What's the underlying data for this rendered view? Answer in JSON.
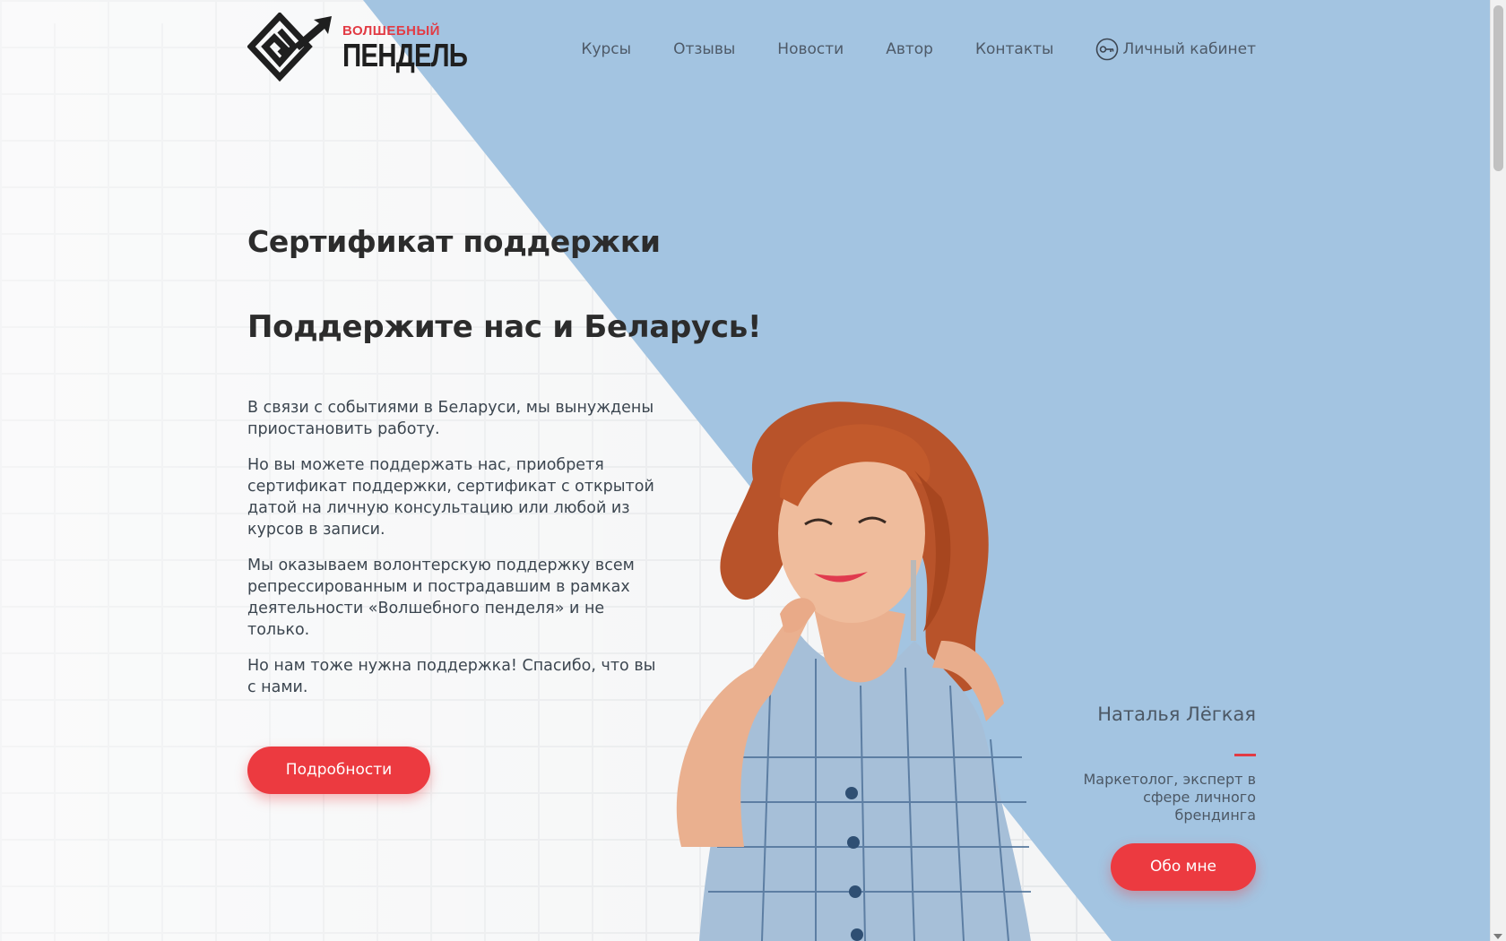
{
  "header": {
    "logo_top": "ВОЛШЕБНЫЙ",
    "logo_bottom": "ПЕНДЕЛЬ",
    "nav": [
      {
        "label": "Курсы"
      },
      {
        "label": "Отзывы"
      },
      {
        "label": "Новости"
      },
      {
        "label": "Автор"
      },
      {
        "label": "Контакты"
      }
    ],
    "cabinet_label": "Личный кабинет",
    "cabinet_icon": "key-icon"
  },
  "main": {
    "title": "Сертификат поддержки",
    "subtitle": "Поддержите нас и Беларусь!",
    "paragraphs": [
      "В связи с событиями в Беларуси, мы вынуждены приостановить работу.",
      "Но вы можете поддержать нас, приобретя сертификат поддержки, сертификат с открытой датой на личную консультацию или любой из курсов в записи.",
      "Мы оказываем волонтерскую поддержку всем репрессированным и пострадавшим в рамках деятельности «Волшебного пенделя» и не только.",
      "Но нам тоже нужна поддержка! Спасибо, что вы с нами."
    ],
    "details_button": "Подробности"
  },
  "author": {
    "name": "Наталья Лёгкая",
    "role": "Маркетолог, эксперт в сфере личного брендинга",
    "about_button": "Обо мне"
  },
  "colors": {
    "accent": "#ec3a40",
    "blue_background": "#a3c4e1",
    "text_dark": "#2c2c2c",
    "nav_text": "#4e5a68"
  }
}
